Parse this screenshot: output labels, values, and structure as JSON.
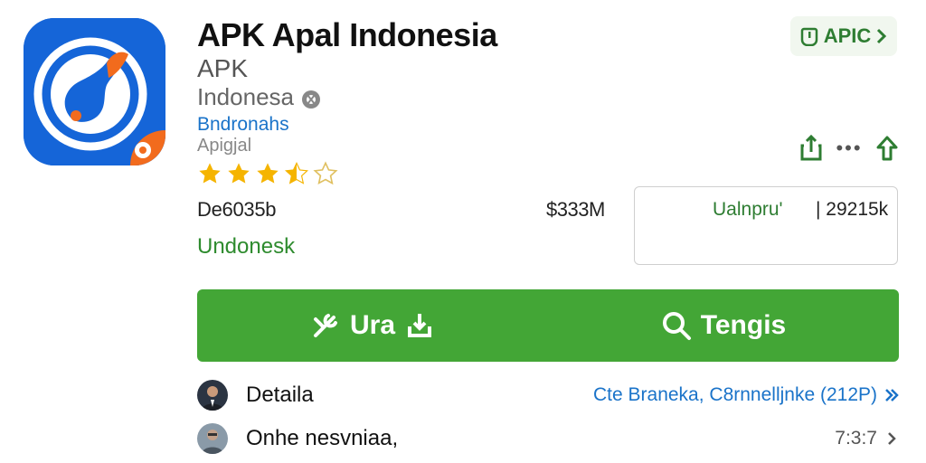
{
  "app": {
    "title": "APK Apal Indonesia",
    "type": "APK",
    "region": "Indonesa",
    "developer": "Bndronahs",
    "category": "Apigjal",
    "rating": 3.5,
    "rating_max": 5,
    "version": "De6035b",
    "size": "$333M",
    "publisher": "Undonesk"
  },
  "badge": {
    "label": "APIC"
  },
  "download": {
    "label": "Ualnpru'",
    "count": "| 29215k"
  },
  "action_bar": {
    "left_label": "Ura",
    "right_label": "Tengis"
  },
  "rows": [
    {
      "label": "Detaila",
      "value": "Cte Branekа, C8rnnelljnke (212P)"
    },
    {
      "label": "Onhe nesvniaa,",
      "value": "7:3:7"
    }
  ],
  "colors": {
    "accent_green": "#43a636",
    "link_blue": "#1a73c9",
    "icon_blue": "#1565d8",
    "icon_orange": "#f26b1d",
    "star_gold": "#f5b400"
  }
}
